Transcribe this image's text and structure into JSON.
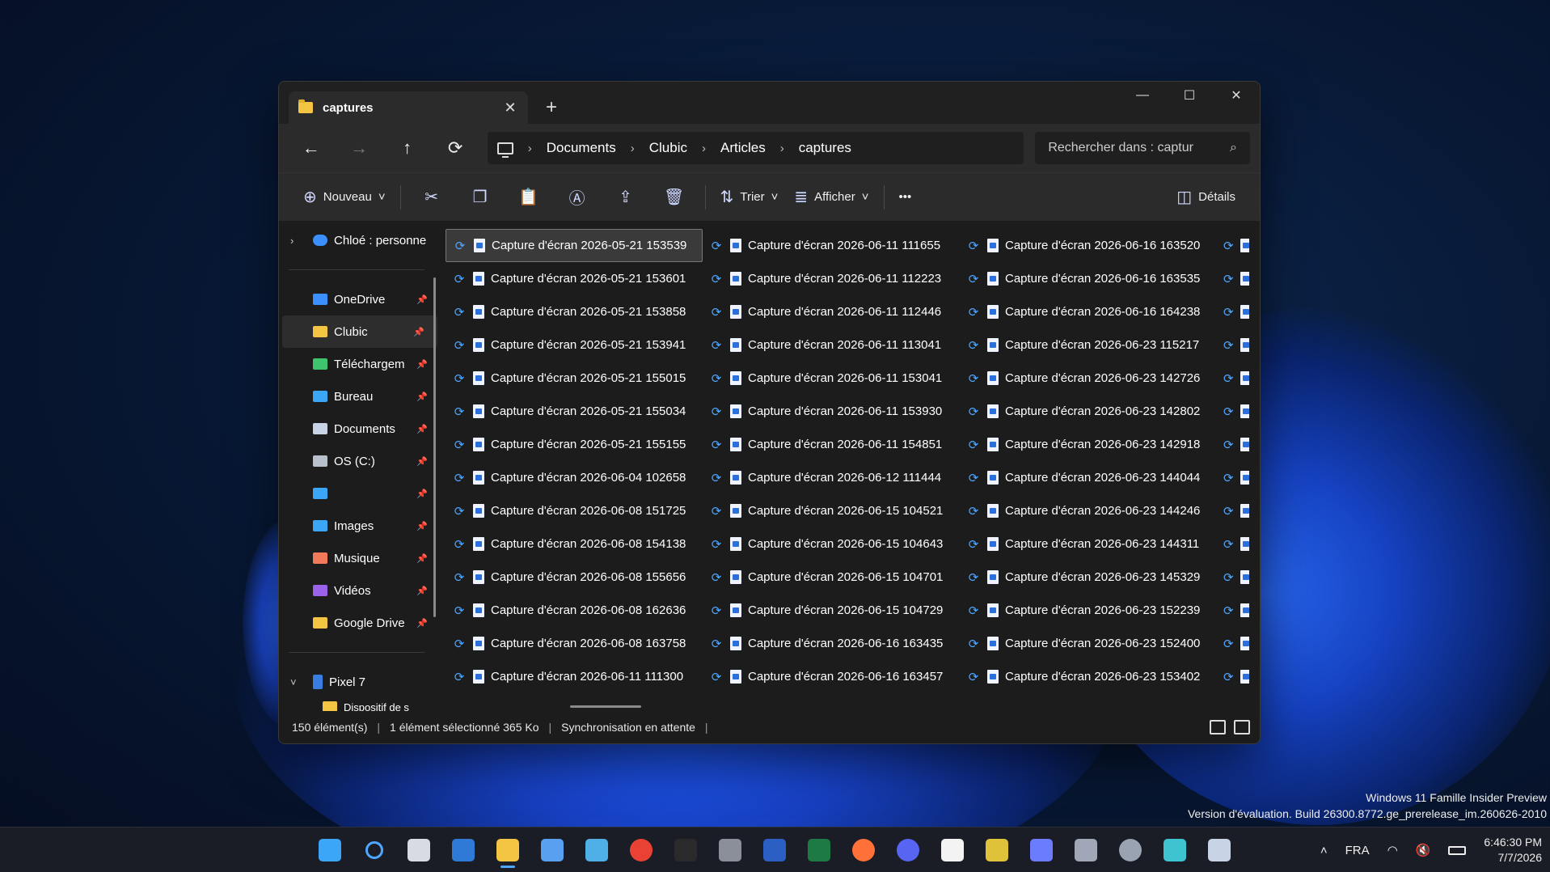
{
  "window": {
    "tab_title": "captures",
    "new_tab": "+",
    "controls": {
      "minimize": "—",
      "maximize": "☐",
      "close": "✕"
    }
  },
  "navigation": {
    "back": "←",
    "forward": "→",
    "up": "↑",
    "refresh": "⟳",
    "breadcrumb": [
      "Documents",
      "Clubic",
      "Articles",
      "captures"
    ],
    "search_placeholder": "Rechercher dans : captur"
  },
  "toolbar": {
    "new_label": "Nouveau",
    "sort_label": "Trier",
    "view_label": "Afficher",
    "more_label": "•••",
    "details_label": "Détails"
  },
  "sidebar": {
    "cloud_root": "Chloé : personne",
    "pinned": [
      {
        "label": "OneDrive",
        "icon": "cloud-icon",
        "color": "#3b8fff"
      },
      {
        "label": "Clubic",
        "icon": "folder-icon",
        "color": "#f4c542"
      },
      {
        "label": "Téléchargem",
        "icon": "download-icon",
        "color": "#3ec46d"
      },
      {
        "label": "Bureau",
        "icon": "desktop-icon",
        "color": "#3aa6f5"
      },
      {
        "label": "Documents",
        "icon": "document-icon",
        "color": "#c9d3e6"
      },
      {
        "label": "OS (C:)",
        "icon": "drive-icon",
        "color": "#b8c0cc"
      },
      {
        "label": "",
        "icon": "monitor-icon",
        "color": "#3aa6f5"
      },
      {
        "label": "Images",
        "icon": "image-icon",
        "color": "#3aa6f5"
      },
      {
        "label": "Musique",
        "icon": "music-icon",
        "color": "#f07a5a"
      },
      {
        "label": "Vidéos",
        "icon": "video-icon",
        "color": "#9a62e8"
      },
      {
        "label": "Google Drive",
        "icon": "folder-icon",
        "color": "#f4c542"
      }
    ],
    "device": "Pixel 7",
    "device_child": "Dispositif de s"
  },
  "files": {
    "columns": [
      [
        "Capture d'écran 2026-05-21 153539",
        "Capture d'écran 2026-05-21 153601",
        "Capture d'écran 2026-05-21 153858",
        "Capture d'écran 2026-05-21 153941",
        "Capture d'écran 2026-05-21 155015",
        "Capture d'écran 2026-05-21 155034",
        "Capture d'écran 2026-05-21 155155",
        "Capture d'écran 2026-06-04 102658",
        "Capture d'écran 2026-06-08 151725",
        "Capture d'écran 2026-06-08 154138",
        "Capture d'écran 2026-06-08 155656",
        "Capture d'écran 2026-06-08 162636",
        "Capture d'écran 2026-06-08 163758",
        "Capture d'écran 2026-06-11 111300"
      ],
      [
        "Capture d'écran 2026-06-11 111655",
        "Capture d'écran 2026-06-11 112223",
        "Capture d'écran 2026-06-11 112446",
        "Capture d'écran 2026-06-11 113041",
        "Capture d'écran 2026-06-11 153041",
        "Capture d'écran 2026-06-11 153930",
        "Capture d'écran 2026-06-11 154851",
        "Capture d'écran 2026-06-12 111444",
        "Capture d'écran 2026-06-15 104521",
        "Capture d'écran 2026-06-15 104643",
        "Capture d'écran 2026-06-15 104701",
        "Capture d'écran 2026-06-15 104729",
        "Capture d'écran 2026-06-16 163435",
        "Capture d'écran 2026-06-16 163457"
      ],
      [
        "Capture d'écran 2026-06-16 163520",
        "Capture d'écran 2026-06-16 163535",
        "Capture d'écran 2026-06-16 164238",
        "Capture d'écran 2026-06-23 115217",
        "Capture d'écran 2026-06-23 142726",
        "Capture d'écran 2026-06-23 142802",
        "Capture d'écran 2026-06-23 142918",
        "Capture d'écran 2026-06-23 144044",
        "Capture d'écran 2026-06-23 144246",
        "Capture d'écran 2026-06-23 144311",
        "Capture d'écran 2026-06-23 145329",
        "Capture d'écran 2026-06-23 152239",
        "Capture d'écran 2026-06-23 152400",
        "Capture d'écran 2026-06-23 153402"
      ]
    ],
    "selected": "Capture d'écran 2026-05-21 153539"
  },
  "status": {
    "count": "150 élément(s)",
    "selection": "1 élément sélectionné  365 Ko",
    "sync": "Synchronisation en attente"
  },
  "watermark": {
    "line1": "Windows 11 Famille Insider Preview",
    "line2": "Version d'évaluation. Build 26300.8772.ge_prerelease_im.260626-2010"
  },
  "taskbar": {
    "apps": [
      {
        "name": "start-icon",
        "color": "#3aa6f5"
      },
      {
        "name": "search-icon",
        "color": "#4ea6ff"
      },
      {
        "name": "task-view-icon",
        "color": "#d8dbe2"
      },
      {
        "name": "widgets-icon",
        "color": "#2f7ad6"
      },
      {
        "name": "file-explorer-icon",
        "color": "#f4c542"
      },
      {
        "name": "notepad-icon",
        "color": "#5aa0f0"
      },
      {
        "name": "photos-icon",
        "color": "#4fb0e8"
      },
      {
        "name": "chrome-icon",
        "color": "#e94235"
      },
      {
        "name": "terminal-icon",
        "color": "#2a2a2a"
      },
      {
        "name": "calculator-icon",
        "color": "#8a8f99"
      },
      {
        "name": "word-icon",
        "color": "#2b5fc4"
      },
      {
        "name": "excel-icon",
        "color": "#1d7a45"
      },
      {
        "name": "firefox-icon",
        "color": "#ff7139"
      },
      {
        "name": "discord-icon",
        "color": "#5865f2"
      },
      {
        "name": "store-icon",
        "color": "#f3f3f3"
      },
      {
        "name": "color-app-icon",
        "color": "#e0c23a"
      },
      {
        "name": "copilot-icon",
        "color": "#6b7cff"
      },
      {
        "name": "control-panel-icon",
        "color": "#a0a8b8"
      },
      {
        "name": "settings-icon",
        "color": "#9aa3b2"
      },
      {
        "name": "vscode-icon",
        "color": "#3ec4d0"
      },
      {
        "name": "remote-desktop-icon",
        "color": "#c9d3e6"
      }
    ],
    "lang": "FRA",
    "time": "6:46:30 PM",
    "date": "7/7/2026"
  }
}
